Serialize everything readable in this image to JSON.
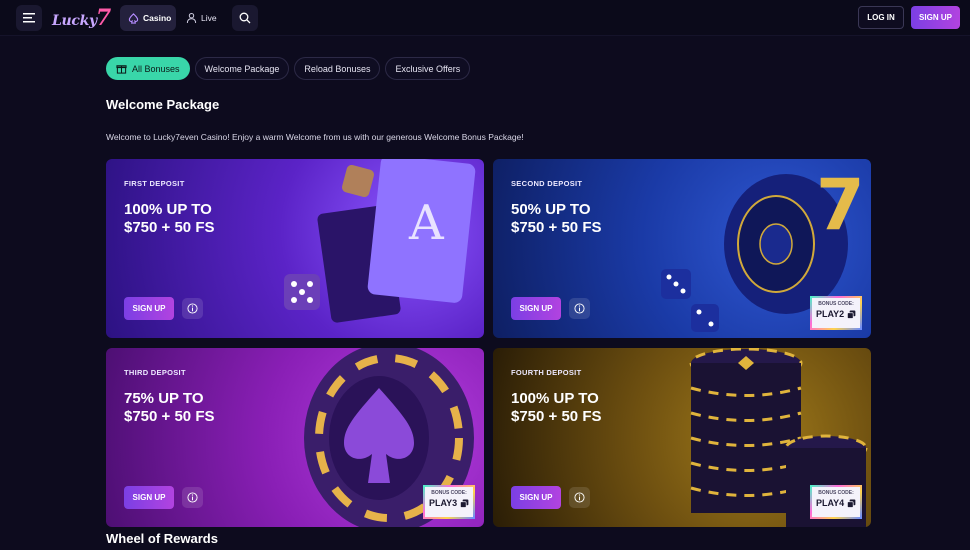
{
  "header": {
    "logo_text": "Lucky",
    "logo_seven": "7",
    "nav": {
      "casino": "Casino",
      "live": "Live"
    },
    "login": "LOG IN",
    "signup": "SIGN UP"
  },
  "filters": [
    "All Bonuses",
    "Welcome Package",
    "Reload Bonuses",
    "Exclusive Offers"
  ],
  "section": {
    "title": "Welcome Package",
    "intro": "Welcome to Lucky7even Casino! Enjoy a warm Welcome from us with our generous Welcome Bonus Package!"
  },
  "cards": [
    {
      "label": "FIRST DEPOSIT",
      "headline1": "100% UP TO",
      "headline2": "$750 + 50 FS",
      "cta": "SIGN UP"
    },
    {
      "label": "SECOND DEPOSIT",
      "headline1": "50% UP TO",
      "headline2": "$750 + 50 FS",
      "cta": "SIGN UP",
      "code_label": "BONUS CODE:",
      "code": "PLAY2"
    },
    {
      "label": "THIRD DEPOSIT",
      "headline1": "75% UP TO",
      "headline2": "$750 + 50 FS",
      "cta": "SIGN UP",
      "code_label": "BONUS CODE:",
      "code": "PLAY3"
    },
    {
      "label": "FOURTH DEPOSIT",
      "headline1": "100% UP TO",
      "headline2": "$750 + 50 FS",
      "cta": "SIGN UP",
      "code_label": "BONUS CODE:",
      "code": "PLAY4"
    }
  ],
  "next_section": {
    "title": "Wheel of Rewards"
  },
  "colors": {
    "accent_green": "#39d6a9",
    "brand_purple": "#7b3fe4",
    "background": "#0d0b1e"
  }
}
